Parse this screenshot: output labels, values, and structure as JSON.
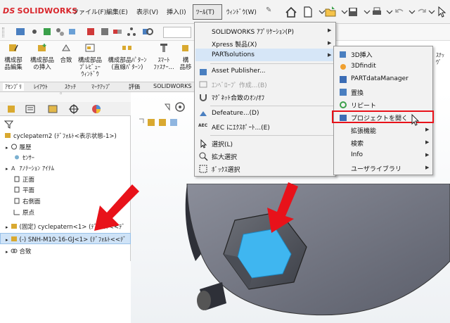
{
  "app": {
    "name": "SOLIDWORKS",
    "mark": "DS"
  },
  "menubar": [
    {
      "label": "ファイル(F)",
      "name": "menu-file"
    },
    {
      "label": "編集(E)",
      "name": "menu-edit"
    },
    {
      "label": "表示(V)",
      "name": "menu-view"
    },
    {
      "label": "挿入(I)",
      "name": "menu-insert"
    },
    {
      "label": "ﾂｰﾙ(T)",
      "name": "menu-tools"
    },
    {
      "label": "ｳｨﾝﾄﾞｳ(W)",
      "name": "menu-window"
    }
  ],
  "ribbon": [
    {
      "l1": "構成部",
      "l2": "品編集",
      "l3": ""
    },
    {
      "l1": "構成部品",
      "l2": "の挿入",
      "l3": ""
    },
    {
      "l1": "合致",
      "l2": "",
      "l3": ""
    },
    {
      "l1": "構成部品",
      "l2": "ﾌﾟﾚﾋﾞｭｰ",
      "l3": "ｳｨﾝﾄﾞｳ"
    },
    {
      "l1": "構成部品ﾊﾟﾀｰﾝ",
      "l2": "(直線ﾊﾟﾀｰﾝ)",
      "l3": ""
    },
    {
      "l1": "ｽﾏｰﾄ",
      "l2": "ﾌｧｽﾅｰ...",
      "l3": ""
    },
    {
      "l1": "構",
      "l2": "品移",
      "l3": ""
    }
  ],
  "tabs": [
    "ｱｾﾝﾌﾞﾘ",
    "ﾚｲｱｳﾄ",
    "ｽｹｯﾁ",
    "ﾏｰｸｱｯﾌﾟ",
    "評価",
    "SOLIDWORKS"
  ],
  "tree": {
    "root": "cyclepatern2 (ﾃﾞﾌｫﾙﾄ<表示状態-1>)",
    "items": [
      "履歴",
      "ｾﾝｻｰ",
      "ｱﾉﾃｰｼｮﾝ ｱｲﾃﾑ",
      "正面",
      "平面",
      "右側面",
      "原点",
      "(固定) cyclepatern<1> (ﾃﾞﾌｫﾙﾄ<<ﾃﾞ",
      "(-) SNH-M10-16-GJ<1> (ﾃﾞﾌｫﾙﾄ<<ﾃﾞ",
      "合致"
    ]
  },
  "dropdown": {
    "items": [
      "SOLIDWORKS ｱﾌﾟﾘｹｰｼｮﾝ(P)",
      "Xpress 製品(X)",
      "PARTsolutions",
      "Asset Publisher...",
      "ｴﾝﾍﾞﾛｰﾌﾟ 作成...(B)",
      "ﾏｸﾞﾈｯﾄ合致のｵﾝ/ｵﾌ",
      "Defeature...(D)",
      "AEC にｴｸｽﾎﾟｰﾄ...(E)",
      "選択(L)",
      "拡大選択",
      "ﾎﾞｯｸｽ選択"
    ],
    "aec": "AEC"
  },
  "submenu": {
    "items": [
      "3D挿入",
      "3Dfindit",
      "PARTdataManager",
      "置換",
      "リピート",
      "プロジェクトを開く",
      "拡張機能",
      "検索",
      "Info",
      "ユーザライブラリ"
    ]
  },
  "colors": {
    "accent": "#d9262c",
    "highlight": "#d6e6f7",
    "red_box": "#e8121a",
    "part_blue": "#3fb6f0",
    "arrow_red": "#e8121a"
  }
}
